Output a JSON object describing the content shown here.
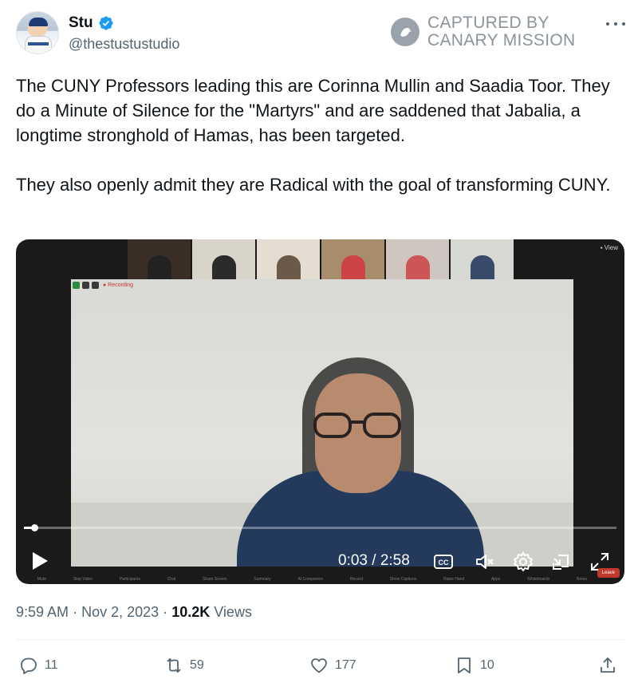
{
  "author": {
    "name": "Stu",
    "handle": "@thestustustudio"
  },
  "watermark": {
    "line1": "CAPTURED BY",
    "line2": "CANARY MISSION"
  },
  "tweet": {
    "paragraph1": "The CUNY Professors leading this are Corinna Mullin and Saadia Toor. They do a Minute of Silence for the \"Martyrs\" and are saddened that Jabalia, a longtime stronghold of Hamas, has been targeted.",
    "paragraph2": "They also openly admit they are Radical with the goal of transforming CUNY."
  },
  "video": {
    "time": "0:03 / 2:58",
    "progress_fraction": 0.017
  },
  "meta": {
    "time": "9:59 AM",
    "date": "Nov 2, 2023",
    "views_count": "10.2K",
    "views_label": "Views",
    "separator": "·"
  },
  "actions": {
    "replies": "11",
    "reposts": "59",
    "likes": "177",
    "bookmarks": "10"
  },
  "colors": {
    "text_primary": "#0f1419",
    "text_secondary": "#536471",
    "verified_blue": "#1d9bf0",
    "watermark_gray": "#8b949c"
  }
}
